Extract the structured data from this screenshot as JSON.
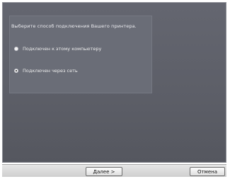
{
  "dialog": {
    "prompt": "Выберите способ подключения Вашего принтера.",
    "options": [
      {
        "label": "Подключен к этому компьютеру",
        "selected": false
      },
      {
        "label": "Подключен через сеть",
        "selected": true
      }
    ]
  },
  "footer": {
    "next_mnemonic": "Д",
    "next_rest": "алее >",
    "cancel_label": "Отмена"
  },
  "colors": {
    "panel": "#5f616a",
    "footer": "#d8d8d8",
    "text_light": "#eeeeee"
  }
}
